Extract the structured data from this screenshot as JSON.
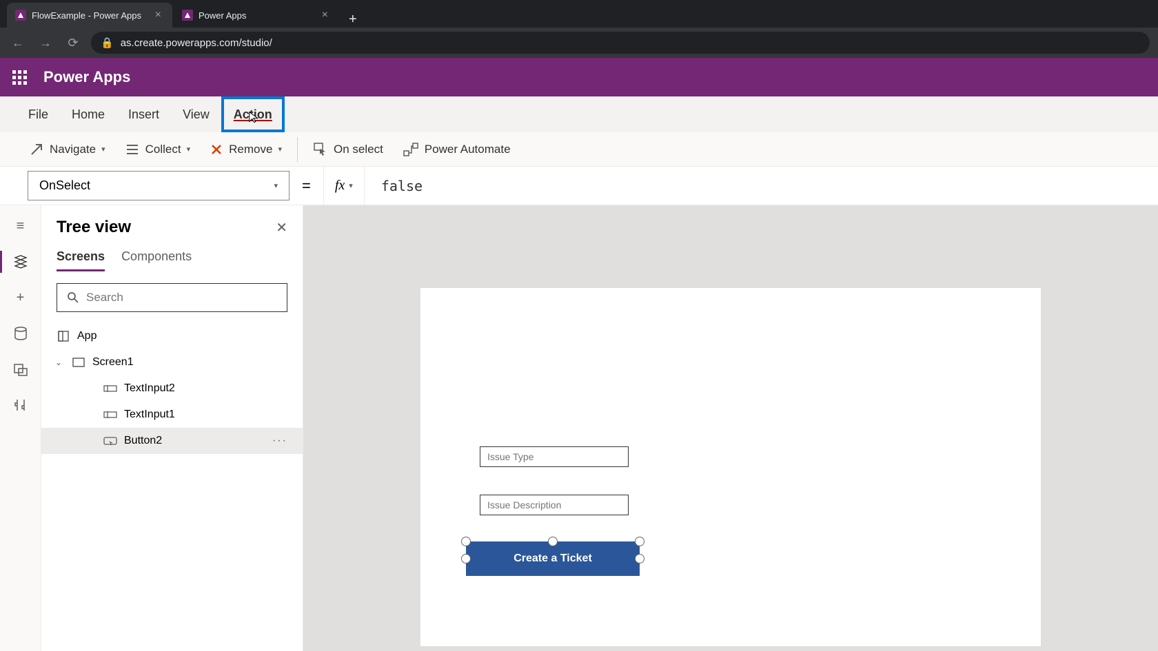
{
  "browser": {
    "tabs": [
      {
        "title": "FlowExample - Power Apps",
        "active": true
      },
      {
        "title": "Power Apps",
        "active": false
      }
    ],
    "url": "as.create.powerapps.com/studio/"
  },
  "header": {
    "app_name": "Power Apps"
  },
  "menu": {
    "items": [
      "File",
      "Home",
      "Insert",
      "View",
      "Action"
    ],
    "active": "Action"
  },
  "ribbon": {
    "navigate": "Navigate",
    "collect": "Collect",
    "remove": "Remove",
    "on_select": "On select",
    "power_automate": "Power Automate"
  },
  "formula": {
    "property": "OnSelect",
    "fx_label": "fx",
    "value": "false"
  },
  "tree": {
    "title": "Tree view",
    "tabs": {
      "screens": "Screens",
      "components": "Components"
    },
    "search_placeholder": "Search",
    "items": {
      "app": "App",
      "screen": "Screen1",
      "ti2": "TextInput2",
      "ti1": "TextInput1",
      "btn2": "Button2"
    }
  },
  "canvas": {
    "input1_placeholder": "Issue Type",
    "input2_placeholder": "Issue Description",
    "button_label": "Create a Ticket"
  }
}
